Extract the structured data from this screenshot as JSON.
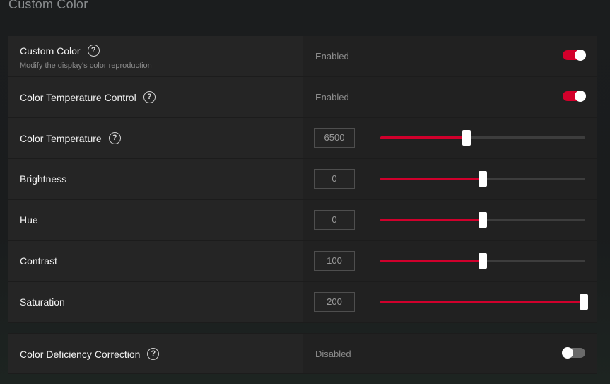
{
  "section_title": "Custom Color",
  "colors": {
    "accent": "#d0002c",
    "toggle_off": "#6a6a6a",
    "panel": "#252525"
  },
  "icons": {
    "help": "help-circle-icon"
  },
  "rows": [
    {
      "id": "custom-color",
      "label": "Custom Color",
      "sub": "Modify the display's color reproduction",
      "help": true,
      "kind": "toggle",
      "state_text": "Enabled",
      "on": true
    },
    {
      "id": "color-temperature-control",
      "label": "Color Temperature Control",
      "help": true,
      "kind": "toggle",
      "state_text": "Enabled",
      "on": true
    },
    {
      "id": "color-temperature",
      "label": "Color Temperature",
      "help": true,
      "kind": "slider",
      "value": "6500",
      "level": 0.42
    },
    {
      "id": "brightness",
      "label": "Brightness",
      "help": false,
      "kind": "slider",
      "value": "0",
      "level": 0.5
    },
    {
      "id": "hue",
      "label": "Hue",
      "help": false,
      "kind": "slider",
      "value": "0",
      "level": 0.5
    },
    {
      "id": "contrast",
      "label": "Contrast",
      "help": false,
      "kind": "slider",
      "value": "100",
      "level": 0.5
    },
    {
      "id": "saturation",
      "label": "Saturation",
      "help": false,
      "kind": "slider",
      "value": "200",
      "level": 1.0
    }
  ],
  "cdc": {
    "label": "Color Deficiency Correction",
    "help": true,
    "state_text": "Disabled",
    "on": false
  }
}
